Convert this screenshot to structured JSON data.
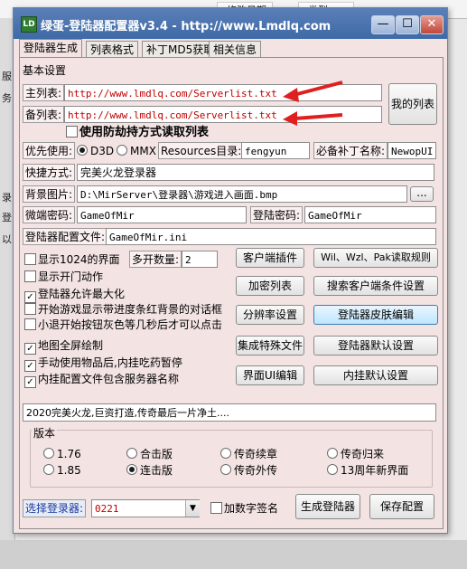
{
  "background_app": {
    "top_text_1": "修改日期",
    "top_text_2": "类型",
    "left_texts": [
      "服",
      "务",
      "录",
      "登",
      "以"
    ]
  },
  "window": {
    "title": "绿蛋-登陆器配置器v3.4 - http://www.Lmdlq.com",
    "icon_text": "LD",
    "min_label": "—",
    "max_label": "☐",
    "close_label": "✕"
  },
  "tabs": [
    {
      "label": "登陆器生成"
    },
    {
      "label": "列表格式"
    },
    {
      "label": "补丁MD5获取"
    },
    {
      "label": "相关信息"
    }
  ],
  "basic": {
    "section_label": "基本设置",
    "main_list_label": "主列表:",
    "main_list_value": "http://www.lmdlq.com/Serverlist.txt",
    "backup_list_label": "备列表:",
    "backup_list_value": "http://www.lmdlq.com/Serverlist.txt",
    "my_list_button": "我的列表",
    "anti_hijack_label": "使用防劫持方式读取列表",
    "priority_label": "优先使用:",
    "d3d_label": "D3D",
    "mmx_label": "MMX",
    "resources_label": "Resources目录:",
    "resources_value": "fengyun",
    "patch_label": "必备补丁名称:",
    "patch_value": "NewopUI",
    "shortcut_label": "快捷方式:",
    "shortcut_value": "完美火龙登录器",
    "bg_label": "背景图片:",
    "bg_value": "D:\\MirServer\\登录器\\游戏进入画面.bmp",
    "browse_button": "...",
    "micro_pwd_label": "微端密码:",
    "micro_pwd_value": "GameOfMir",
    "login_pwd_label": "登陆密码:",
    "login_pwd_value": "GameOfMir",
    "config_file_label": "登陆器配置文件:",
    "config_file_value": "GameOfMir.ini"
  },
  "options": {
    "opt_1024": "显示1024的界面",
    "multi_open_label": "多开数量:",
    "multi_open_value": "2",
    "opt_open_door": "显示开门动作",
    "opt_maximize": "登陆器允许最大化",
    "opt_red_bg": "开始游戏显示带进度条红背景的对话框",
    "opt_small_exit": "小退开始按钮灰色等几秒后才可以点击",
    "opt_fullmap": "地图全屏绘制",
    "opt_pause": "手动使用物品后,内挂吃药暂停",
    "opt_config": "内挂配置文件包含服务器名称"
  },
  "buttons": {
    "client_plugin": "客户端插件",
    "wil_rules": "Wil、Wzl、Pak读取规则",
    "encrypt_list": "加密列表",
    "search_client": "搜索客户端条件设置",
    "resolution": "分辨率设置",
    "skin_edit": "登陆器皮肤编辑",
    "integrate_files": "集成特殊文件",
    "default_login": "登陆器默认设置",
    "ui_edit": "界面UI编辑",
    "default_plugin": "内挂默认设置"
  },
  "announcement": "2020完美火龙,巨资打造,传奇最后一片净土....",
  "version": {
    "group_label": "版本",
    "options": [
      {
        "label": "1.76"
      },
      {
        "label": "合击版"
      },
      {
        "label": "传奇续章"
      },
      {
        "label": "传奇归来"
      },
      {
        "label": "1.85"
      },
      {
        "label": "连击版"
      },
      {
        "label": "传奇外传"
      },
      {
        "label": "13周年新界面"
      }
    ]
  },
  "bottom": {
    "select_label": "选择登录器:",
    "select_value": "0221",
    "sign_label": "加数字签名",
    "generate_button": "生成登陆器",
    "save_button": "保存配置"
  },
  "colors": {
    "title_bar": "#4872af",
    "panel_bg": "#f3e3e3",
    "url_text": "#c00000",
    "arrow": "#e02020"
  }
}
